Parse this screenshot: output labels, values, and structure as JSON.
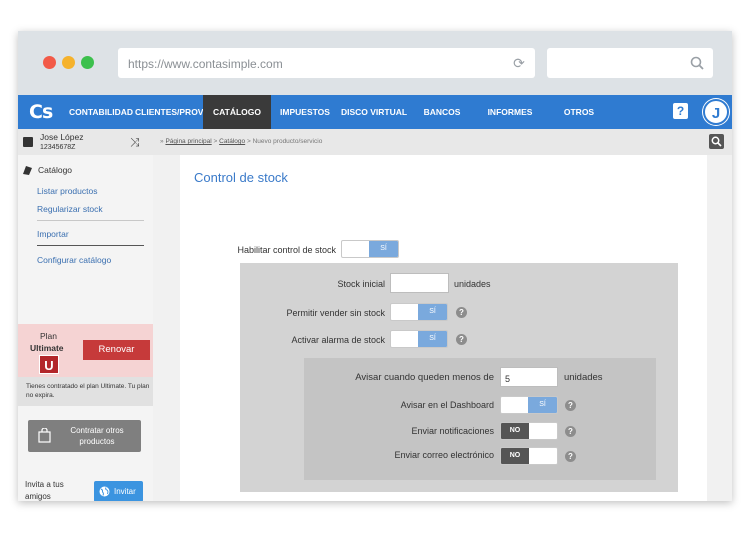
{
  "browser": {
    "url": "https://www.contasimple.com"
  },
  "navbar": {
    "logo": "Cs",
    "items": [
      "CONTABILIDAD",
      "CLIENTES/PROV.",
      "CATÁLOGO",
      "IMPUESTOS",
      "DISCO VIRTUAL",
      "BANCOS",
      "INFORMES",
      "OTROS"
    ],
    "active_index": 2,
    "help": "?",
    "avatar": "J",
    "brand_color": "#2f7bd1"
  },
  "sidebar": {
    "user_name": "Jose López",
    "user_id": "12345678Z",
    "section_title": "Catálogo",
    "links": [
      "Listar productos",
      "Regularizar stock",
      "Importar",
      "Configurar catálogo"
    ],
    "plan_label": "Plan",
    "plan_name": "Ultimate",
    "plan_badge": "U",
    "renew_button": "Renovar",
    "plan_note": "Tienes contratado el plan Ultimate. Tu plan no expira.",
    "contract_button": "Contratar otros productos",
    "invite_text": "Invita a tus amigos",
    "invite_button": "Invitar"
  },
  "breadcrumb": {
    "items": [
      "Página principal",
      "Catálogo",
      "Nuevo producto/servicio"
    ],
    "prefix": "»",
    "separator": ">"
  },
  "form": {
    "title": "Control de stock",
    "enable_stock": {
      "label": "Habilitar control de stock",
      "value": "SÍ"
    },
    "initial_stock": {
      "label": "Stock inicial",
      "value": "",
      "unit": "unidades"
    },
    "allow_sell": {
      "label": "Permitir vender sin stock",
      "value": "SÍ"
    },
    "stock_alarm": {
      "label": "Activar alarma de stock",
      "value": "SÍ"
    },
    "alert_threshold": {
      "label": "Avisar cuando queden menos de",
      "value": "5",
      "unit": "unidades"
    },
    "dashboard_alert": {
      "label": "Avisar en el Dashboard",
      "value": "SÍ"
    },
    "notifications": {
      "label": "Enviar notificaciones",
      "value": "NO"
    },
    "email": {
      "label": "Enviar correo electrónico",
      "value": "NO"
    },
    "help_icon": "?"
  }
}
